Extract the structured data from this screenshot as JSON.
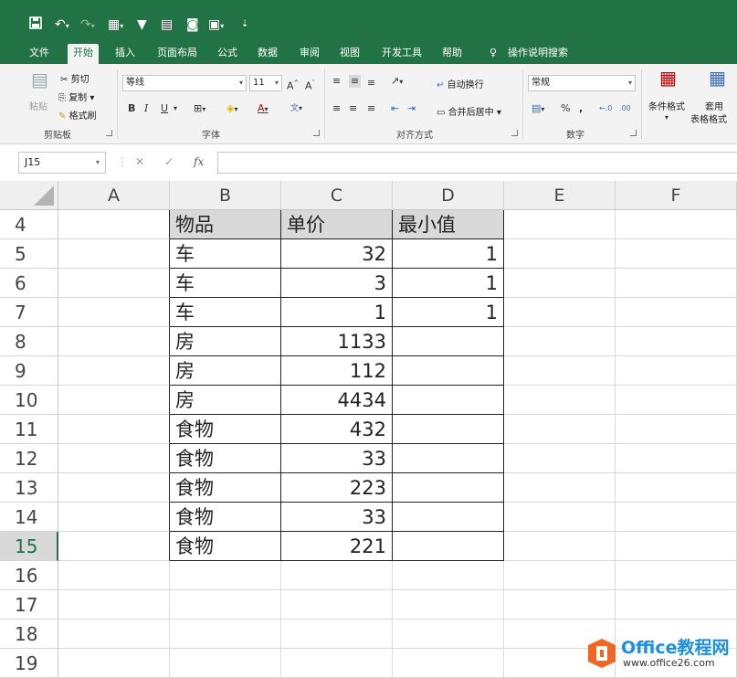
{
  "qat": {
    "save_icon": "save-icon",
    "undo_icon": "undo-icon",
    "redo_icon": "redo-icon",
    "filter_icon": "filter-icon"
  },
  "tabs": [
    "文件",
    "开始",
    "插入",
    "页面布局",
    "公式",
    "数据",
    "审阅",
    "视图",
    "开发工具",
    "帮助",
    "操作说明搜索"
  ],
  "active_tab": "开始",
  "ribbon": {
    "clipboard": {
      "paste": "粘贴",
      "cut": "剪切",
      "copy": "复制",
      "format_painter": "格式刷",
      "label": "剪贴板"
    },
    "font": {
      "name": "等线",
      "size": "11",
      "bold": "B",
      "italic": "I",
      "underline": "U",
      "label": "字体"
    },
    "alignment": {
      "wrap": "自动换行",
      "merge": "合并后居中",
      "label": "对齐方式"
    },
    "number": {
      "format": "常规",
      "percent": "%",
      "comma": ",",
      "label": "数字"
    },
    "styles": {
      "conditional": "条件格式",
      "table_1": "套用",
      "table_2": "表格格式"
    }
  },
  "formula_bar": {
    "name_box": "J15",
    "cancel": "✕",
    "enter": "✓",
    "fx": "fx",
    "content": ""
  },
  "columns": [
    "A",
    "B",
    "C",
    "D",
    "E",
    "F"
  ],
  "rows": [
    "4",
    "5",
    "6",
    "7",
    "8",
    "9",
    "10",
    "11",
    "12",
    "13",
    "14",
    "15",
    "16",
    "17",
    "18",
    "19"
  ],
  "selected_row": "15",
  "table": {
    "headers": [
      "物品",
      "单价",
      "最小值"
    ],
    "data": [
      [
        "车",
        "32",
        "1"
      ],
      [
        "车",
        "3",
        "1"
      ],
      [
        "车",
        "1",
        "1"
      ],
      [
        "房",
        "1133",
        ""
      ],
      [
        "房",
        "112",
        ""
      ],
      [
        "房",
        "4434",
        ""
      ],
      [
        "食物",
        "432",
        ""
      ],
      [
        "食物",
        "33",
        ""
      ],
      [
        "食物",
        "223",
        ""
      ],
      [
        "食物",
        "33",
        ""
      ],
      [
        "食物",
        "221",
        ""
      ]
    ]
  },
  "watermark": {
    "title": "Office教程网",
    "url": "www.office26.com"
  },
  "colors": {
    "accent": "#217346",
    "header_fill": "#d9d9d9",
    "watermark_orange": "#f26522"
  }
}
